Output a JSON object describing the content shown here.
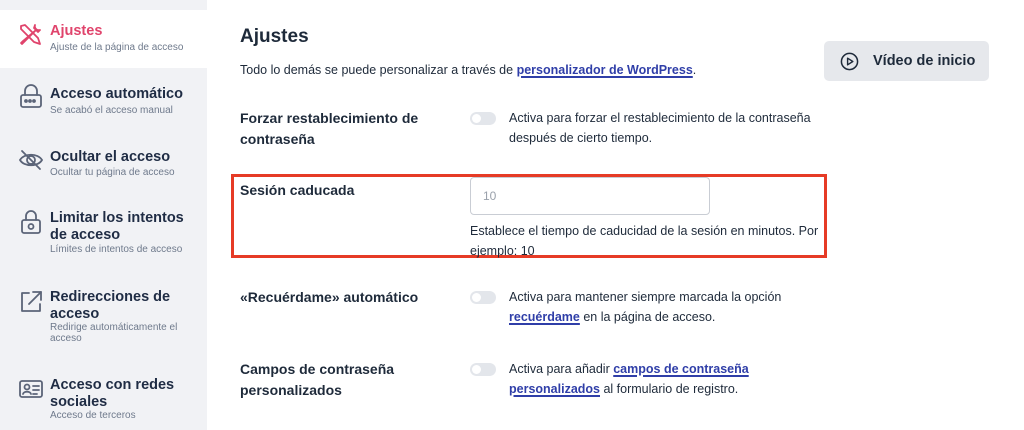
{
  "sidebar": {
    "items": [
      {
        "title": "Ajustes",
        "subtitle": "Ajuste de la página de acceso",
        "icon": "tools-icon",
        "active": true
      },
      {
        "title": "Acceso automático",
        "subtitle": "Se acabó el acceso manual",
        "icon": "lock-key-icon"
      },
      {
        "title": "Ocultar el acceso",
        "subtitle": "Ocultar tu página de acceso",
        "icon": "eye-off-icon"
      },
      {
        "title": "Limitar los intentos de acceso",
        "title_l1": "Limitar los intentos",
        "title_l2": "de acceso",
        "subtitle": "Límites de intentos de acceso",
        "icon": "lock-limit-icon"
      },
      {
        "title": "Redirecciones de acceso",
        "title_l1": "Redirecciones de",
        "title_l2": "acceso",
        "subtitle": "Redirige automáticamente el acceso",
        "subtitle_l1": "Redirige automáticamente el",
        "subtitle_l2": "acceso",
        "icon": "external-link-icon"
      },
      {
        "title": "Acceso con redes sociales",
        "title_l1": "Acceso con redes",
        "title_l2": "sociales",
        "subtitle": "Acceso de terceros",
        "icon": "id-card-icon"
      }
    ]
  },
  "main": {
    "title": "Ajustes",
    "intro_prefix": "Todo lo demás se puede personalizar a través de ",
    "intro_link": "personalizador de WordPress",
    "intro_suffix": ".",
    "video_button": "Vídeo de inicio",
    "settings": {
      "force_reset": {
        "label_l1": "Forzar restablecimiento de",
        "label_l2": "contraseña",
        "desc_l1": "Activa para forzar el restablecimiento de la contraseña",
        "desc_l2": "después de cierto tiempo.",
        "enabled": false
      },
      "session_expired": {
        "label": "Sesión caducada",
        "placeholder": "10",
        "help_l1": "Establece el tiempo de caducidad de la sesión en minutos. Por",
        "help_l2": "ejemplo: 10"
      },
      "remember_me": {
        "label": "«Recuérdame» automático",
        "desc_l1": "Activa para mantener siempre marcada la opción",
        "desc_link": "recuérdame",
        "desc_l2_suffix": " en la página de acceso.",
        "enabled": false
      },
      "custom_password": {
        "label_l1": "Campos de contraseña",
        "label_l2": "personalizados",
        "desc_prefix": "Activa para añadir ",
        "desc_link_l1": "campos de contraseña",
        "desc_link_l2": "personalizados",
        "desc_l2_suffix": " al formulario de registro.",
        "enabled": false
      }
    }
  },
  "colors": {
    "accent": "#e0446c",
    "link": "#2f3ea8",
    "highlight_border": "#e63b26",
    "sidebar_bg": "#f1f2f5"
  }
}
